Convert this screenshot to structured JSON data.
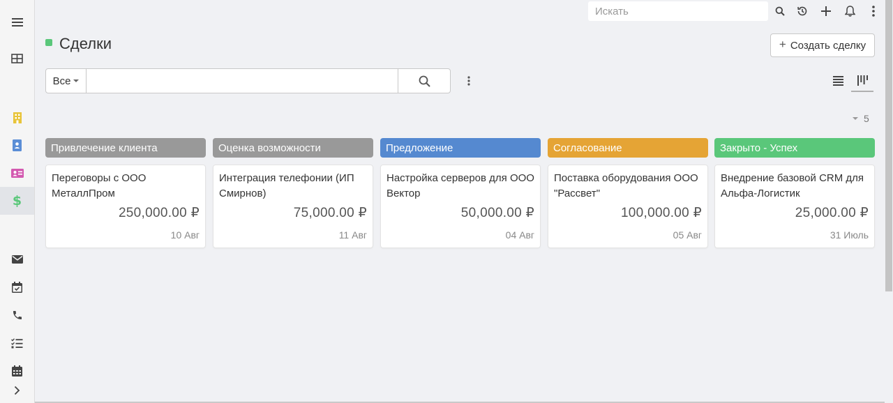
{
  "topbar": {
    "search_placeholder": "Искать"
  },
  "sidebar": {
    "items": [
      {
        "icon": "menu-icon"
      },
      {
        "icon": "grid-icon"
      },
      {
        "icon": "building-icon",
        "color": "#e8c43a"
      },
      {
        "icon": "contact-book-icon",
        "color": "#5b8ed6"
      },
      {
        "icon": "id-card-icon",
        "color": "#d35ab0"
      },
      {
        "icon": "dollar-icon",
        "color": "#5ac77a",
        "active": true
      },
      {
        "icon": "envelope-icon"
      },
      {
        "icon": "calendar-check-icon"
      },
      {
        "icon": "phone-icon"
      },
      {
        "icon": "tasks-icon"
      },
      {
        "icon": "calendar-icon"
      },
      {
        "icon": "chevron-right-icon"
      }
    ]
  },
  "header": {
    "title": "Сделки",
    "title_color": "#5ac77a",
    "create_label": "Создать сделку"
  },
  "filter": {
    "selected": "Все",
    "query": ""
  },
  "board": {
    "total_count": "5",
    "columns": [
      {
        "label": "Привлечение клиента",
        "color": "#999999",
        "cards": [
          {
            "title": "Переговоры с ООО МеталлПром",
            "amount": "250,000.00 ₽",
            "date": "10 Авг"
          }
        ]
      },
      {
        "label": "Оценка возможности",
        "color": "#999999",
        "cards": [
          {
            "title": "Интеграция телефонии (ИП Смирнов)",
            "amount": "75,000.00 ₽",
            "date": "11 Авг"
          }
        ]
      },
      {
        "label": "Предложение",
        "color": "#5589d0",
        "cards": [
          {
            "title": "Настройка серверов для ООО Вектор",
            "amount": "50,000.00 ₽",
            "date": "04 Авг"
          }
        ]
      },
      {
        "label": "Согласование",
        "color": "#e5a435",
        "cards": [
          {
            "title": "Поставка оборудования ООО \"Рассвет\"",
            "amount": "100,000.00 ₽",
            "date": "05 Авг"
          }
        ]
      },
      {
        "label": "Закрыто - Успех",
        "color": "#5ac77a",
        "cards": [
          {
            "title": "Внедрение базовой CRM для Альфа-Логистик",
            "amount": "25,000.00 ₽",
            "date": "31 Июль"
          }
        ]
      }
    ]
  }
}
